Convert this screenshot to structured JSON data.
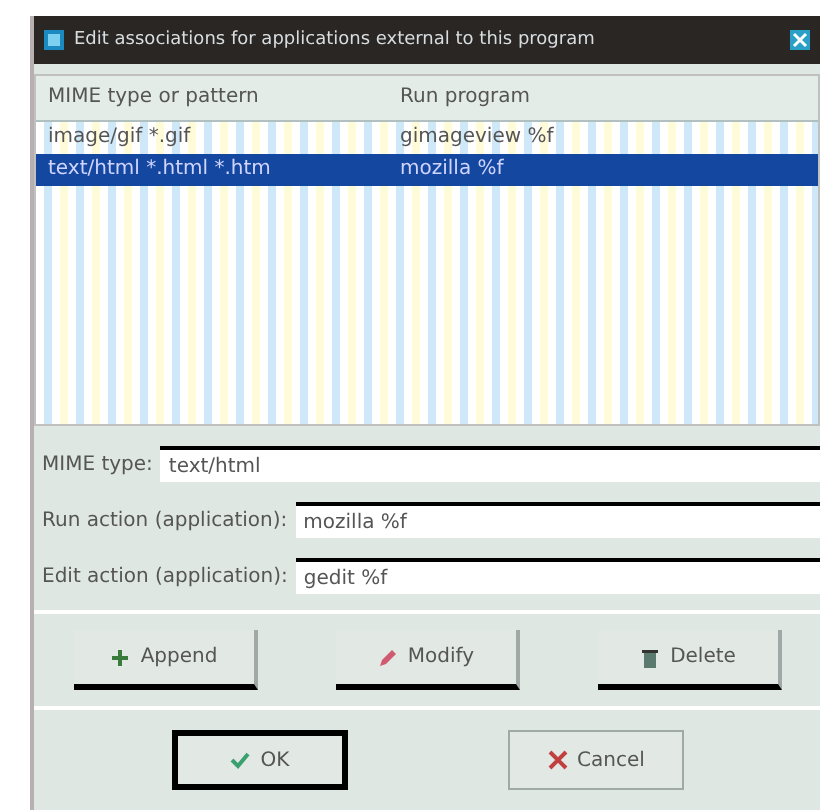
{
  "window": {
    "title": "Edit associations for applications external to this program"
  },
  "table": {
    "columns": [
      "MIME type or pattern",
      "Run program"
    ],
    "rows": [
      {
        "cells": [
          "image/gif  *.gif",
          "gimageview %f"
        ],
        "selected": false
      },
      {
        "cells": [
          "text/html  *.html *.htm",
          "mozilla %f"
        ],
        "selected": true
      }
    ]
  },
  "form": [
    {
      "label": "MIME type:",
      "value": "text/html"
    },
    {
      "label": "Run action (application):",
      "value": "mozilla %f"
    },
    {
      "label": "Edit action (application):",
      "value": "gedit %f"
    }
  ],
  "actions": [
    {
      "label": "Append",
      "kind": "append"
    },
    {
      "label": "Modify",
      "kind": "modify"
    },
    {
      "label": "Delete",
      "kind": "delete"
    }
  ],
  "buttons": [
    {
      "label": "OK",
      "kind": "ok",
      "default": true
    },
    {
      "label": "Cancel",
      "kind": "cancel",
      "default": false
    }
  ]
}
